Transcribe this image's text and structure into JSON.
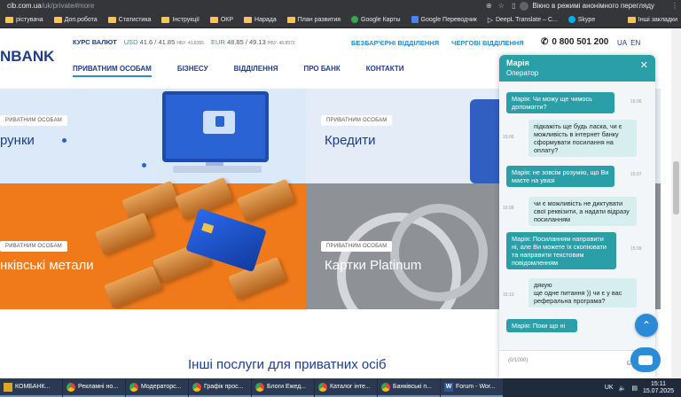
{
  "browser": {
    "url_host": "cib.com.ua",
    "url_path": "/uk/private#more",
    "incognito_label": "Вікно в режимі анонімного перегляду",
    "bookmarks": [
      {
        "label": "рістувача",
        "icon": "folder-icon"
      },
      {
        "label": "Доп.робота",
        "icon": "folder-icon"
      },
      {
        "label": "Статистика",
        "icon": "folder-icon"
      },
      {
        "label": "Інструкції",
        "icon": "folder-icon"
      },
      {
        "label": "ОКР",
        "icon": "folder-icon"
      },
      {
        "label": "Нарада",
        "icon": "folder-icon"
      },
      {
        "label": "План развития",
        "icon": "folder-icon"
      },
      {
        "label": "Google Карты",
        "icon": "maps-icon"
      },
      {
        "label": "Google Переводчик",
        "icon": "translate-icon"
      },
      {
        "label": "DeepL Translate – С...",
        "icon": "deepl-icon"
      },
      {
        "label": "Skype",
        "icon": "skype-icon"
      }
    ],
    "other_bookmarks": "Інші закладки"
  },
  "site": {
    "logo_text": "NBANK",
    "rates": {
      "label": "КУРС ВАЛЮТ",
      "usd_code": "USD",
      "usd_value": "41.6 / 41.85",
      "usd_nbu": "НБУ: 41.8355",
      "eur_code": "EUR",
      "eur_value": "48.85 / 49.13",
      "eur_nbu": "НБУ: 48.8973"
    },
    "toplinks": [
      "БЕЗБАР'ЄРНІ ВІДДІЛЕННЯ",
      "ЧЕРГОВІ ВІДДІЛЕННЯ"
    ],
    "phone": "0 800 501 200",
    "langs": [
      "UA",
      "EN"
    ],
    "nav": [
      "ПРИВАТНИМ ОСОБАМ",
      "БІЗНЕСУ",
      "ВІДДІЛЕННЯ",
      "ПРО БАНК",
      "КОНТАКТИ"
    ],
    "tiles": [
      {
        "pill": "РИВАТНИМ ОСОБАМ",
        "title": "рунки"
      },
      {
        "pill": "ПРИВАТНИМ ОСОБАМ",
        "title": "Кредити"
      },
      {
        "pill": "РИВАТНИМ ОСОБАМ",
        "title": "нківські метали"
      },
      {
        "pill": "ПРИВАТНИМ ОСОБАМ",
        "title": "Картки Platinum"
      }
    ],
    "other_services_title": "Інші послуги для приватних осіб"
  },
  "chat": {
    "operator_name": "Марія",
    "operator_role": "Оператор",
    "messages": [
      {
        "from": "op",
        "text": "Марія: Чи можу ще чимось допомогти?",
        "time": "15:06"
      },
      {
        "from": "me",
        "text": "підкажіть ще будь ласка, чи є можливість в інтернет банку сформувати посилання на оплату?",
        "time": "15:06"
      },
      {
        "from": "op",
        "text": "Марія: не зовсім розумію, що Ви маєте на увазі",
        "time": "15:07"
      },
      {
        "from": "me",
        "text": "чи є можливість не диктувати свої реквізити, а надати відразу посиланням",
        "time": "15:08"
      },
      {
        "from": "op",
        "text": "Марія: Посиланням направити ні, але Ви можете їх скопіювати та направити текстовим повідомленням",
        "time": "15:09"
      },
      {
        "from": "me",
        "text": "дякую\nще одне питання )) чи є у вас реферальна програма?",
        "time": "15:10"
      },
      {
        "from": "op",
        "text": "Марія: Поки що ні",
        "time": ""
      }
    ],
    "input_placeholder": "(0/1000)"
  },
  "taskbar": {
    "items": [
      {
        "label": "КОМБАНК...",
        "icon": "folder-icon"
      },
      {
        "label": "Рекламні но...",
        "icon": "chrome-icon"
      },
      {
        "label": "Модераторс...",
        "icon": "chrome-icon"
      },
      {
        "label": "Графік прос...",
        "icon": "chrome-icon"
      },
      {
        "label": "Блоги Ежед...",
        "icon": "chrome-icon"
      },
      {
        "label": "Каталог інте...",
        "icon": "chrome-icon"
      },
      {
        "label": "Банківські п...",
        "icon": "chrome-icon"
      },
      {
        "label": "Forum - Wor...",
        "icon": "word-icon"
      }
    ],
    "lang": "UK",
    "time": "15:11",
    "date": "15.07.2025"
  }
}
